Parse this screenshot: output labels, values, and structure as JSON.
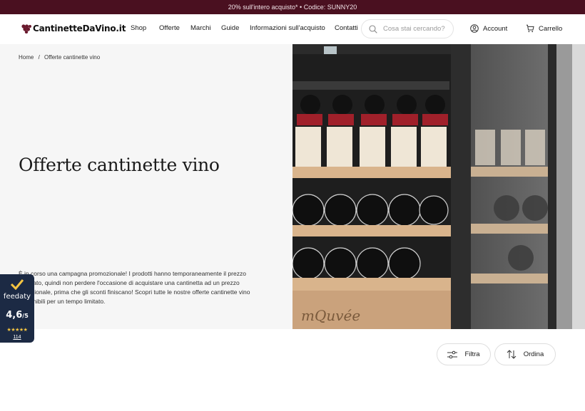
{
  "promo": {
    "text": "20% sull'intero acquisto* • Codice: SUNNY20"
  },
  "header": {
    "logo_text": "CantinetteDaVino.it",
    "nav": [
      "Shop",
      "Offerte",
      "Marchi",
      "Guide",
      "Informazioni sull'acquisto",
      "Contatti"
    ],
    "search_placeholder": "Cosa stai cercando?",
    "account_label": "Account",
    "cart_label": "Carrello"
  },
  "hero": {
    "breadcrumb_home": "Home",
    "breadcrumb_sep": "/",
    "breadcrumb_current": "Offerte cantinette vino",
    "title": "Offerte cantinette vino",
    "description": "È in corso una campagna promozionale! I prodotti hanno temporaneamente il prezzo scontato, quindi non perdere l'occasione di acquistare una cantinetta ad un prezzo eccezionale, prima che gli sconti finiscano! Scopri tutte le nostre offerte cantinette vino disponibili per un tempo limitato.",
    "brand_on_image": "mQuvée"
  },
  "feedaty": {
    "name": "feedaty",
    "score": "4,6",
    "scale": "/5",
    "stars": "★★★★★",
    "count": "114"
  },
  "toolbar": {
    "filter_label": "Filtra",
    "sort_label": "Ordina"
  },
  "colors": {
    "promo_bg": "#4a1020",
    "badge_bg": "#1c2a44",
    "star": "#f5c542"
  }
}
